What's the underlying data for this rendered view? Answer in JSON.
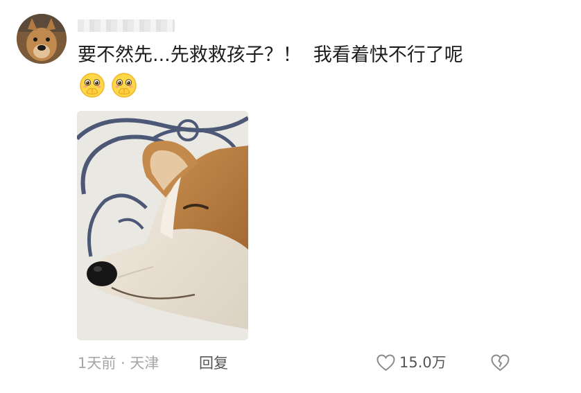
{
  "comment": {
    "text": "要不然先...先救救孩子？！  我看着快不行了呢",
    "emojis": [
      "pleading-hands-emoji",
      "pleading-hands-emoji"
    ]
  },
  "meta": {
    "time_location": "1天前 · 天津",
    "reply_label": "回复"
  },
  "likes": {
    "count": "15.0万"
  },
  "icons": {
    "like": "heart-outline-icon",
    "dislike": "broken-heart-icon"
  }
}
